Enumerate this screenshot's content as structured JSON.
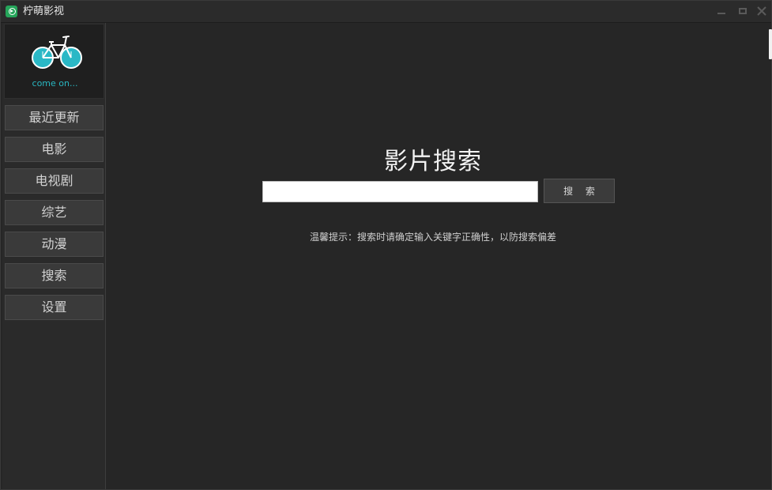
{
  "window": {
    "title": "柠萌影视",
    "controls": [
      "minimize",
      "maximize",
      "close"
    ]
  },
  "sidebar": {
    "logo_text": "come on...",
    "items": [
      {
        "label": "最近更新"
      },
      {
        "label": "电影"
      },
      {
        "label": "电视剧"
      },
      {
        "label": "综艺"
      },
      {
        "label": "动漫"
      },
      {
        "label": "搜索"
      },
      {
        "label": "设置"
      }
    ]
  },
  "main": {
    "title": "影片搜索",
    "search": {
      "value": "",
      "placeholder": ""
    },
    "search_button": "搜 索",
    "hint": "温馨提示：搜索时请确定输入关键字正确性，以防搜索偏差"
  },
  "colors": {
    "background": "#262626",
    "sidebar": "#2a2a2a",
    "accent": "#29b7c2",
    "app_icon": "#25a55a"
  },
  "icons": {
    "app": "app-logo-icon",
    "logo": "bicycle-icon"
  }
}
